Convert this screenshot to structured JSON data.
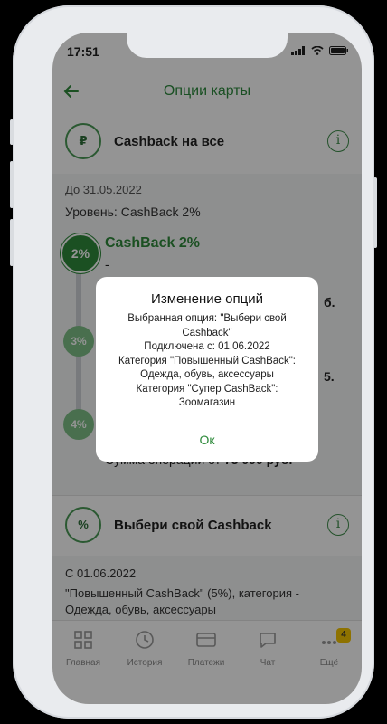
{
  "status_bar": {
    "time": "17:51"
  },
  "header": {
    "title": "Опции карты"
  },
  "cashback_all": {
    "title": "Cashback на все",
    "until": "До 31.05.2022",
    "level_line": "Уровень: CashBack 2%",
    "levels": [
      "2%",
      "3%",
      "4%"
    ],
    "level_title": "CashBack 2%",
    "level_dash": "-",
    "fragment_1": "б.",
    "fragment_2": "5.",
    "operation_text": "Сумма операции от",
    "operation_amount": "75 000 руб."
  },
  "choose_cashback": {
    "title": "Выбери свой Cashback",
    "since": "С 01.06.2022",
    "desc_line1": "\"Повышенный CashBack\" (5%), категория -",
    "desc_line2": "Одежда, обувь, аксессуары"
  },
  "bottom_nav": {
    "items": [
      {
        "label": "Главная"
      },
      {
        "label": "История"
      },
      {
        "label": "Платежи"
      },
      {
        "label": "Чат"
      },
      {
        "label": "Ещё"
      }
    ],
    "more_badge": "4"
  },
  "modal": {
    "title": "Изменение опций",
    "line1": "Выбранная опция: \"Выбери свой",
    "line2": "Cashback\"",
    "line3": "Подключена с: 01.06.2022",
    "line4": "Категория \"Повышенный CashBack\":",
    "line5": "Одежда, обувь, аксессуары",
    "line6": "Категория \"Супер CashBack\":",
    "line7": "Зоомагазин",
    "ok": "Ок"
  },
  "colors": {
    "accent": "#2f8b3c",
    "badge": "#f4c400"
  }
}
